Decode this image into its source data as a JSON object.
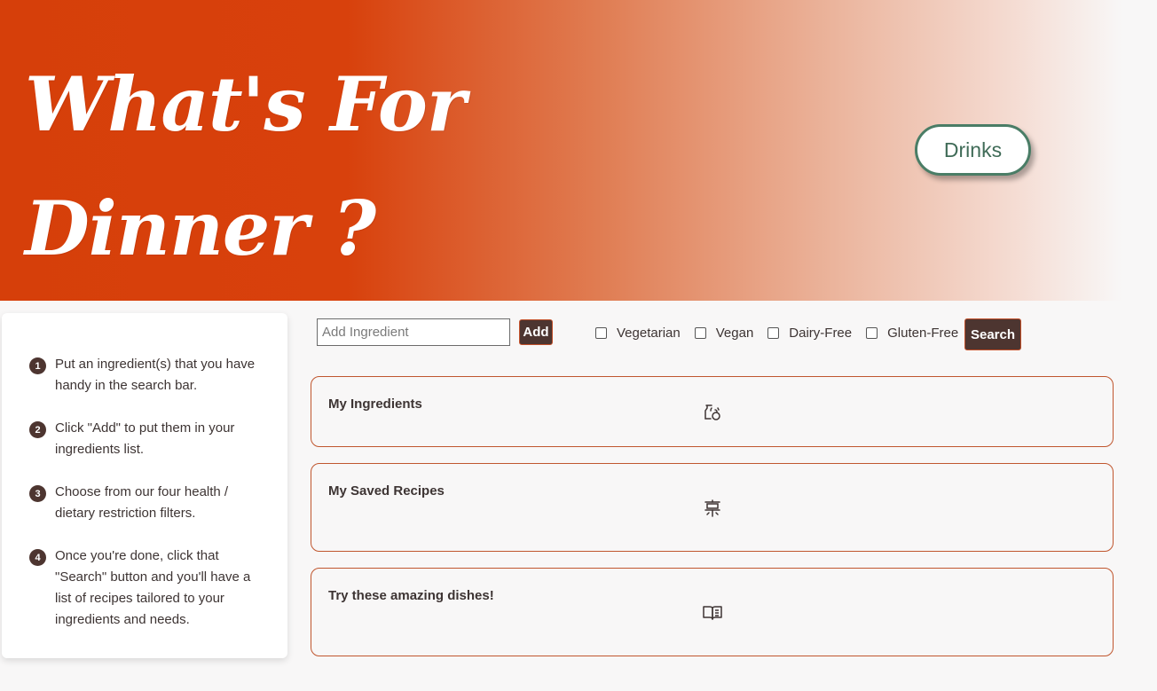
{
  "header": {
    "title": "What's For Dinner ?",
    "drinks_label": "Drinks"
  },
  "sidebar": {
    "steps": [
      {
        "num": "1",
        "text": "Put an ingredient(s) that you have handy in the search bar."
      },
      {
        "num": "2",
        "text": "Click \"Add\" to put them in your ingredients list."
      },
      {
        "num": "3",
        "text": "Choose from our four health / dietary restriction filters."
      },
      {
        "num": "4",
        "text": "Once you're done, click that \"Search\" button and you'll have a list of recipes tailored to your ingredients and needs."
      }
    ]
  },
  "search": {
    "placeholder": "Add Ingredient",
    "value": "",
    "add_label": "Add",
    "search_label": "Search",
    "filters": [
      {
        "label": "Vegetarian",
        "checked": false
      },
      {
        "label": "Vegan",
        "checked": false
      },
      {
        "label": "Dairy-Free",
        "checked": false
      },
      {
        "label": "Gluten-Free",
        "checked": false
      }
    ]
  },
  "cards": [
    {
      "title": "My Ingredients",
      "icon": "ingredients-icon"
    },
    {
      "title": "My Saved Recipes",
      "icon": "signpost-icon"
    },
    {
      "title": "Try these amazing dishes!",
      "icon": "open-book-icon"
    }
  ],
  "colors": {
    "brand_orange": "#d63f0a",
    "button_brown": "#4d3530",
    "drinks_border": "#4a7d66",
    "card_border": "#c0562e"
  }
}
